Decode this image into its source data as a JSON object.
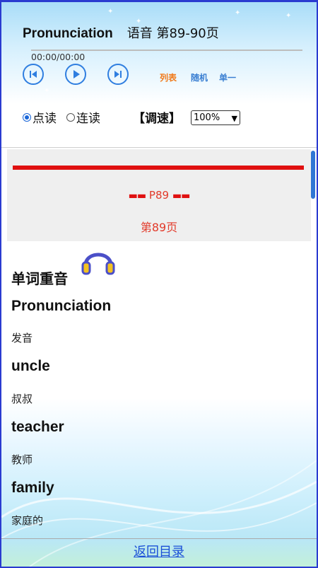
{
  "header": {
    "title_en": "Pronunciation",
    "title_cn": "语音 第89-90页",
    "time": "00:00/00:00"
  },
  "player": {
    "prev_icon": "skip-back-icon",
    "play_icon": "play-icon",
    "next_icon": "skip-forward-icon",
    "modes": [
      "列表",
      "随机",
      "单一"
    ]
  },
  "reading": {
    "options": [
      {
        "label": "点读",
        "checked": true
      },
      {
        "label": "连读",
        "checked": false
      }
    ],
    "speed_label": "【调速】",
    "speed_value": "100%"
  },
  "page": {
    "number_label": "P89",
    "page_label": "第89页"
  },
  "section": {
    "title": "单词重音"
  },
  "words": [
    {
      "en": "Pronunciation",
      "cn": "发音"
    },
    {
      "en": "uncle",
      "cn": "叔叔"
    },
    {
      "en": "teacher",
      "cn": "教师"
    },
    {
      "en": "family",
      "cn": "家庭的"
    }
  ],
  "footer": {
    "back_label": "返回目录"
  },
  "colors": {
    "accent_blue": "#2f7ee0",
    "red": "#e01010",
    "mode_active": "#f07a1a"
  }
}
